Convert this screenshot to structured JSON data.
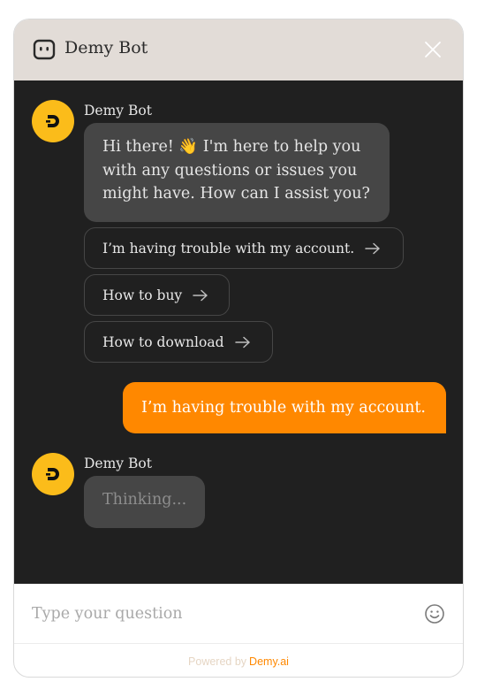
{
  "header": {
    "title": "Demy Bot",
    "icon": "chat-bot-icon",
    "close_icon": "close-icon"
  },
  "messages": [
    {
      "role": "bot",
      "sender": "Demy Bot",
      "text": "Hi there! 👋 I'm here to help you with any questions or issues you might have. How can I assist you?"
    },
    {
      "role": "user",
      "text": "I’m having trouble with my account."
    },
    {
      "role": "bot",
      "sender": "Demy Bot",
      "text": "Thinking..."
    }
  ],
  "quick_replies": [
    "I’m having trouble with my account.",
    "How to buy",
    "How to download"
  ],
  "input": {
    "placeholder": "Type your question",
    "value": ""
  },
  "footer": {
    "powered_by": "Powered by",
    "brand": "Demy.ai"
  },
  "colors": {
    "accent": "#ff8800",
    "avatar": "#fbbc1a",
    "header_bg": "#e2dcd7",
    "chat_bg": "#202020",
    "bubble_bg": "#464646"
  }
}
